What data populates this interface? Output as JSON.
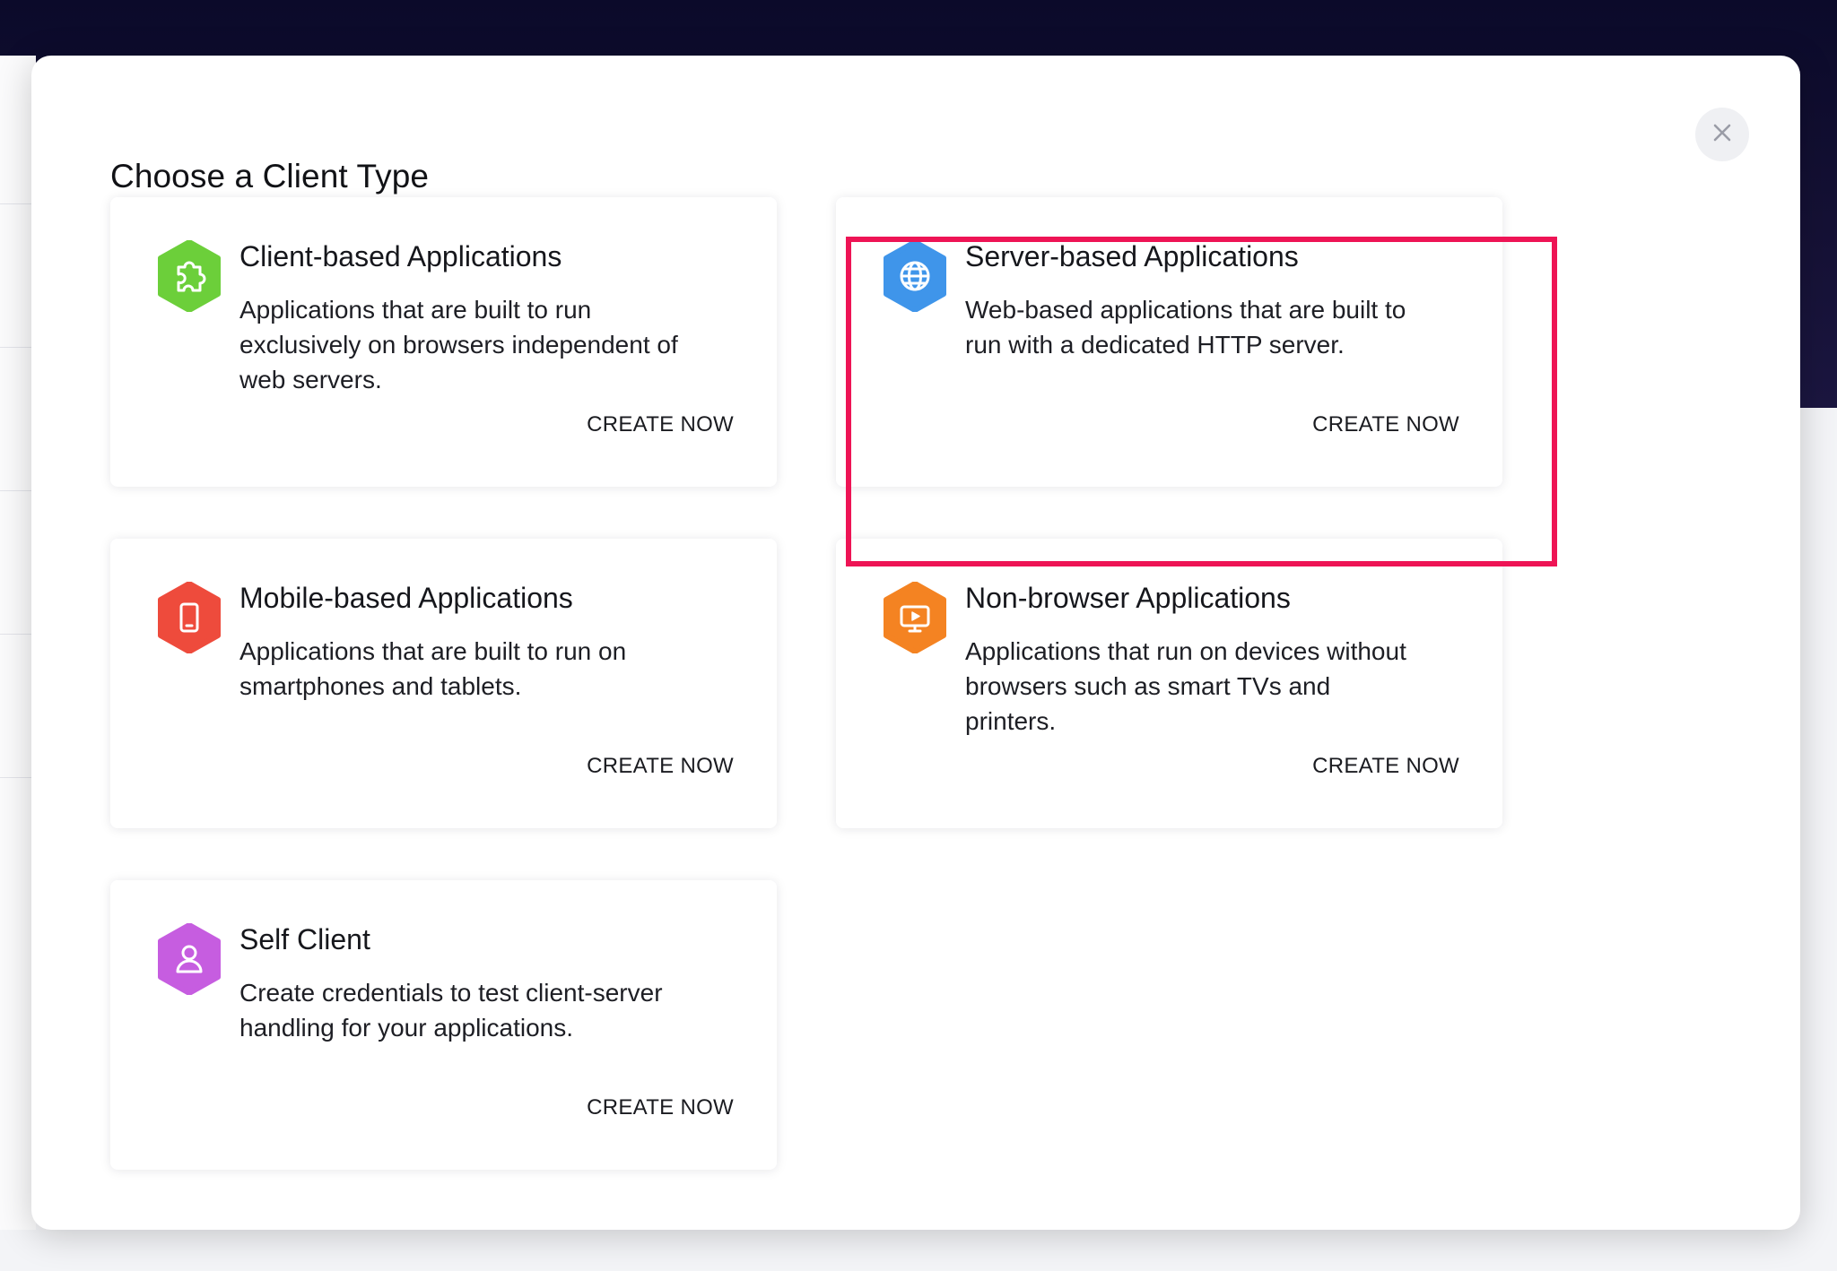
{
  "modal": {
    "title": "Choose a Client Type",
    "close_icon": "close-icon"
  },
  "cards": [
    {
      "title": "Client-based Applications",
      "description": "Applications that are built to run exclusively on browsers independent of web servers.",
      "cta": "CREATE NOW",
      "icon": "puzzle-icon",
      "color": "#6ccf3a"
    },
    {
      "title": "Server-based Applications",
      "description": "Web-based applications that are built to run with a dedicated HTTP server.",
      "cta": "CREATE NOW",
      "icon": "globe-icon",
      "color": "#3f95ea",
      "highlighted": true
    },
    {
      "title": "Mobile-based Applications",
      "description": "Applications that are built to run on smartphones and tablets.",
      "cta": "CREATE NOW",
      "icon": "smartphone-icon",
      "color": "#ee4b3c"
    },
    {
      "title": "Non-browser Applications",
      "description": "Applications that run on devices without browsers such as smart TVs and printers.",
      "cta": "CREATE NOW",
      "icon": "monitor-icon",
      "color": "#f48322"
    },
    {
      "title": "Self Client",
      "description": "Create credentials to test client-server handling for your applications.",
      "cta": "CREATE NOW",
      "icon": "user-icon",
      "color": "#c65de0"
    }
  ],
  "colors": {
    "highlight": "#ee1455",
    "header_bg": "#0b0a2a"
  }
}
